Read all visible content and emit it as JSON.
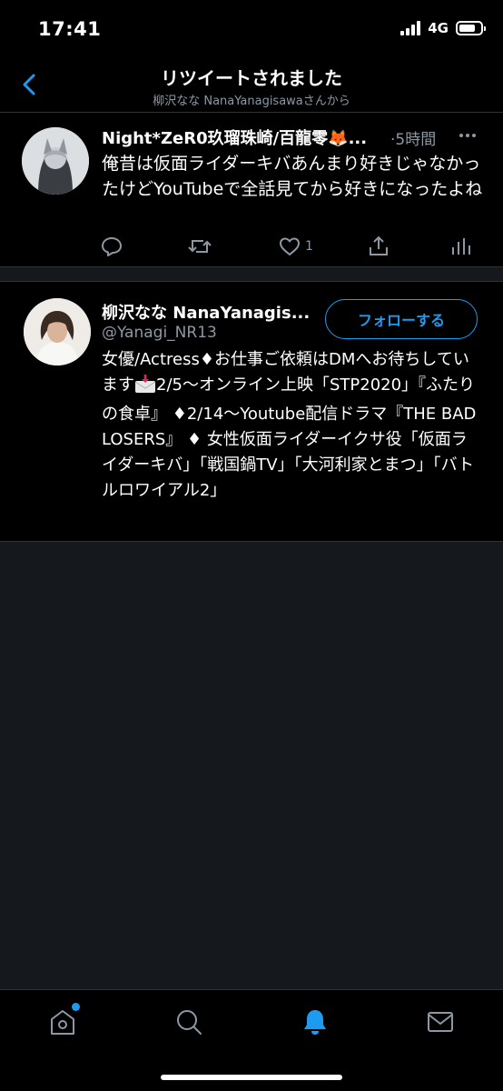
{
  "status": {
    "time": "17:41",
    "network": "4G"
  },
  "header": {
    "title": "リツイートされました",
    "subtitle": "柳沢なな NanaYanagisawaさんから"
  },
  "tweet": {
    "name": "Night*ZeR0玖瑠珠崎/百龍零🦊...",
    "time": "·5時間",
    "text": "俺昔は仮面ライダーキバあんまり好きじゃなかったけどYouTubeで全話見てから好きになったよね",
    "like_count": "1"
  },
  "profile": {
    "name": "柳沢なな NanaYanagis...",
    "handle": "@Yanagi_NR13",
    "follow_label": "フォローする",
    "bio_part1": "女優/Actress♦お仕事ご依頼はDMへお待ちしています",
    "bio_part2": "2/5〜オンライン上映「STP2020」『ふたりの食卓』 ♦2/14〜Youtube配信ドラマ『THE BAD LOSERS』 ♦ 女性仮面ライダーイクサ役「仮面ライダーキバ」「戦国鍋TV」「大河利家とまつ」「バトルロワイアル2」"
  },
  "tabs": [
    "home",
    "search",
    "notifications",
    "messages"
  ],
  "colors": {
    "accent": "#1d9bf0",
    "muted": "#8b98a5",
    "background": "#15181d"
  }
}
